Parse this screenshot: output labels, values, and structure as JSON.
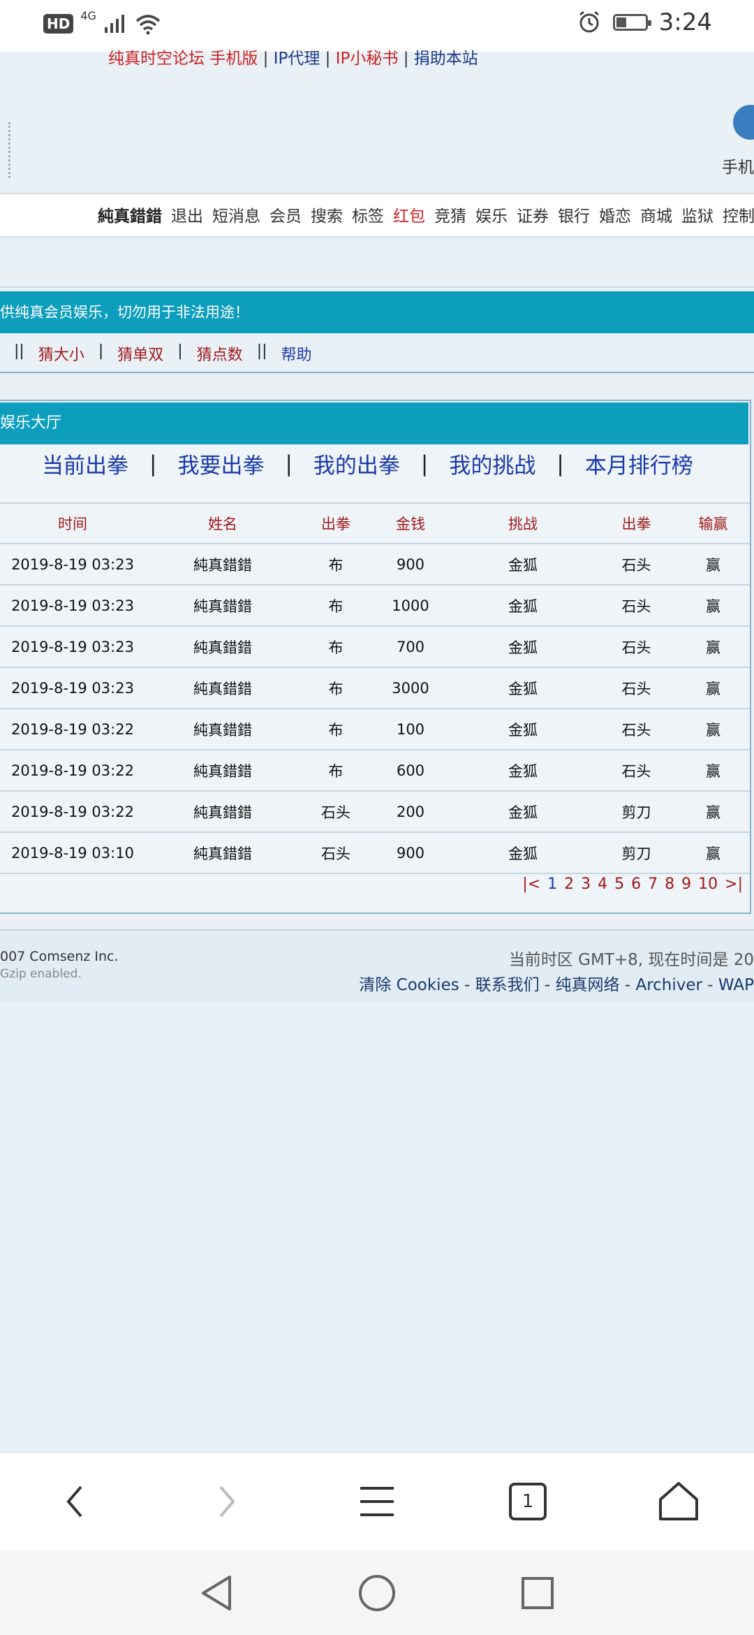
{
  "status_bar": {
    "hd": "HD",
    "network": "4G",
    "time": "3:24",
    "icons": [
      "signal-icon",
      "wifi-icon",
      "alarm-icon",
      "battery-icon"
    ]
  },
  "top_links": {
    "forum": "纯真时空论坛",
    "mobile": "手机版",
    "ip_proxy": "IP代理",
    "ip_secretary": "IP小秘书",
    "donate": "捐助本站",
    "separator": "|"
  },
  "header": {
    "mobile_text": "手机"
  },
  "nav": {
    "user": "純真錯錯",
    "items": [
      "退出",
      "短消息",
      "会员",
      "搜索",
      "标签",
      "红包",
      "竞猜",
      "娱乐",
      "证券",
      "银行",
      "婚恋",
      "商城",
      "监狱",
      "控制面"
    ],
    "highlight_item": "红包"
  },
  "notice": "供纯真会员娱乐，切勿用于非法用途！",
  "subnav": {
    "sep": "||",
    "bar": "|",
    "items": [
      "猜大小",
      "猜单双",
      "猜点数",
      "帮助"
    ]
  },
  "hall": {
    "title": "娱乐大厅",
    "tab_sep": "|",
    "tabs": [
      "当前出拳",
      "我要出拳",
      "我的出拳",
      "我的挑战",
      "本月排行榜"
    ],
    "columns": [
      "时间",
      "姓名",
      "出拳",
      "金钱",
      "挑战",
      "出拳",
      "输赢"
    ],
    "rows": [
      [
        "2019-8-19 03:23",
        "純真錯錯",
        "布",
        "900",
        "金狐",
        "石头",
        "赢"
      ],
      [
        "2019-8-19 03:23",
        "純真錯錯",
        "布",
        "1000",
        "金狐",
        "石头",
        "赢"
      ],
      [
        "2019-8-19 03:23",
        "純真錯錯",
        "布",
        "700",
        "金狐",
        "石头",
        "赢"
      ],
      [
        "2019-8-19 03:23",
        "純真錯錯",
        "布",
        "3000",
        "金狐",
        "石头",
        "赢"
      ],
      [
        "2019-8-19 03:22",
        "純真錯錯",
        "布",
        "100",
        "金狐",
        "石头",
        "赢"
      ],
      [
        "2019-8-19 03:22",
        "純真錯錯",
        "布",
        "600",
        "金狐",
        "石头",
        "赢"
      ],
      [
        "2019-8-19 03:22",
        "純真錯錯",
        "石头",
        "200",
        "金狐",
        "剪刀",
        "赢"
      ],
      [
        "2019-8-19 03:10",
        "純真錯錯",
        "石头",
        "900",
        "金狐",
        "剪刀",
        "赢"
      ]
    ],
    "pager": {
      "first": "|<",
      "last": ">|",
      "pages": [
        "1",
        "2",
        "3",
        "4",
        "5",
        "6",
        "7",
        "8",
        "9",
        "10"
      ],
      "current": "1"
    }
  },
  "footer": {
    "copyright": "007 Comsenz Inc.",
    "gzip": "Gzip enabled.",
    "timezone": "当前时区 GMT+8, 现在时间是 20",
    "links": [
      "清除 Cookies",
      "联系我们",
      "纯真网络",
      "Archiver",
      "WAP"
    ],
    "link_sep": " - "
  },
  "browser_bar": {
    "tab_count": "1",
    "icons": [
      "back-icon",
      "forward-icon",
      "menu-icon",
      "tabs-icon",
      "home-icon"
    ]
  },
  "system_nav": {
    "icons": [
      "back-triangle-icon",
      "home-circle-icon",
      "recents-square-icon"
    ]
  },
  "colors": {
    "accent_teal": "#0d9dbd",
    "link_blue": "#1a3aa8",
    "link_red": "#a01a1a",
    "background": "#eaf1f6"
  }
}
